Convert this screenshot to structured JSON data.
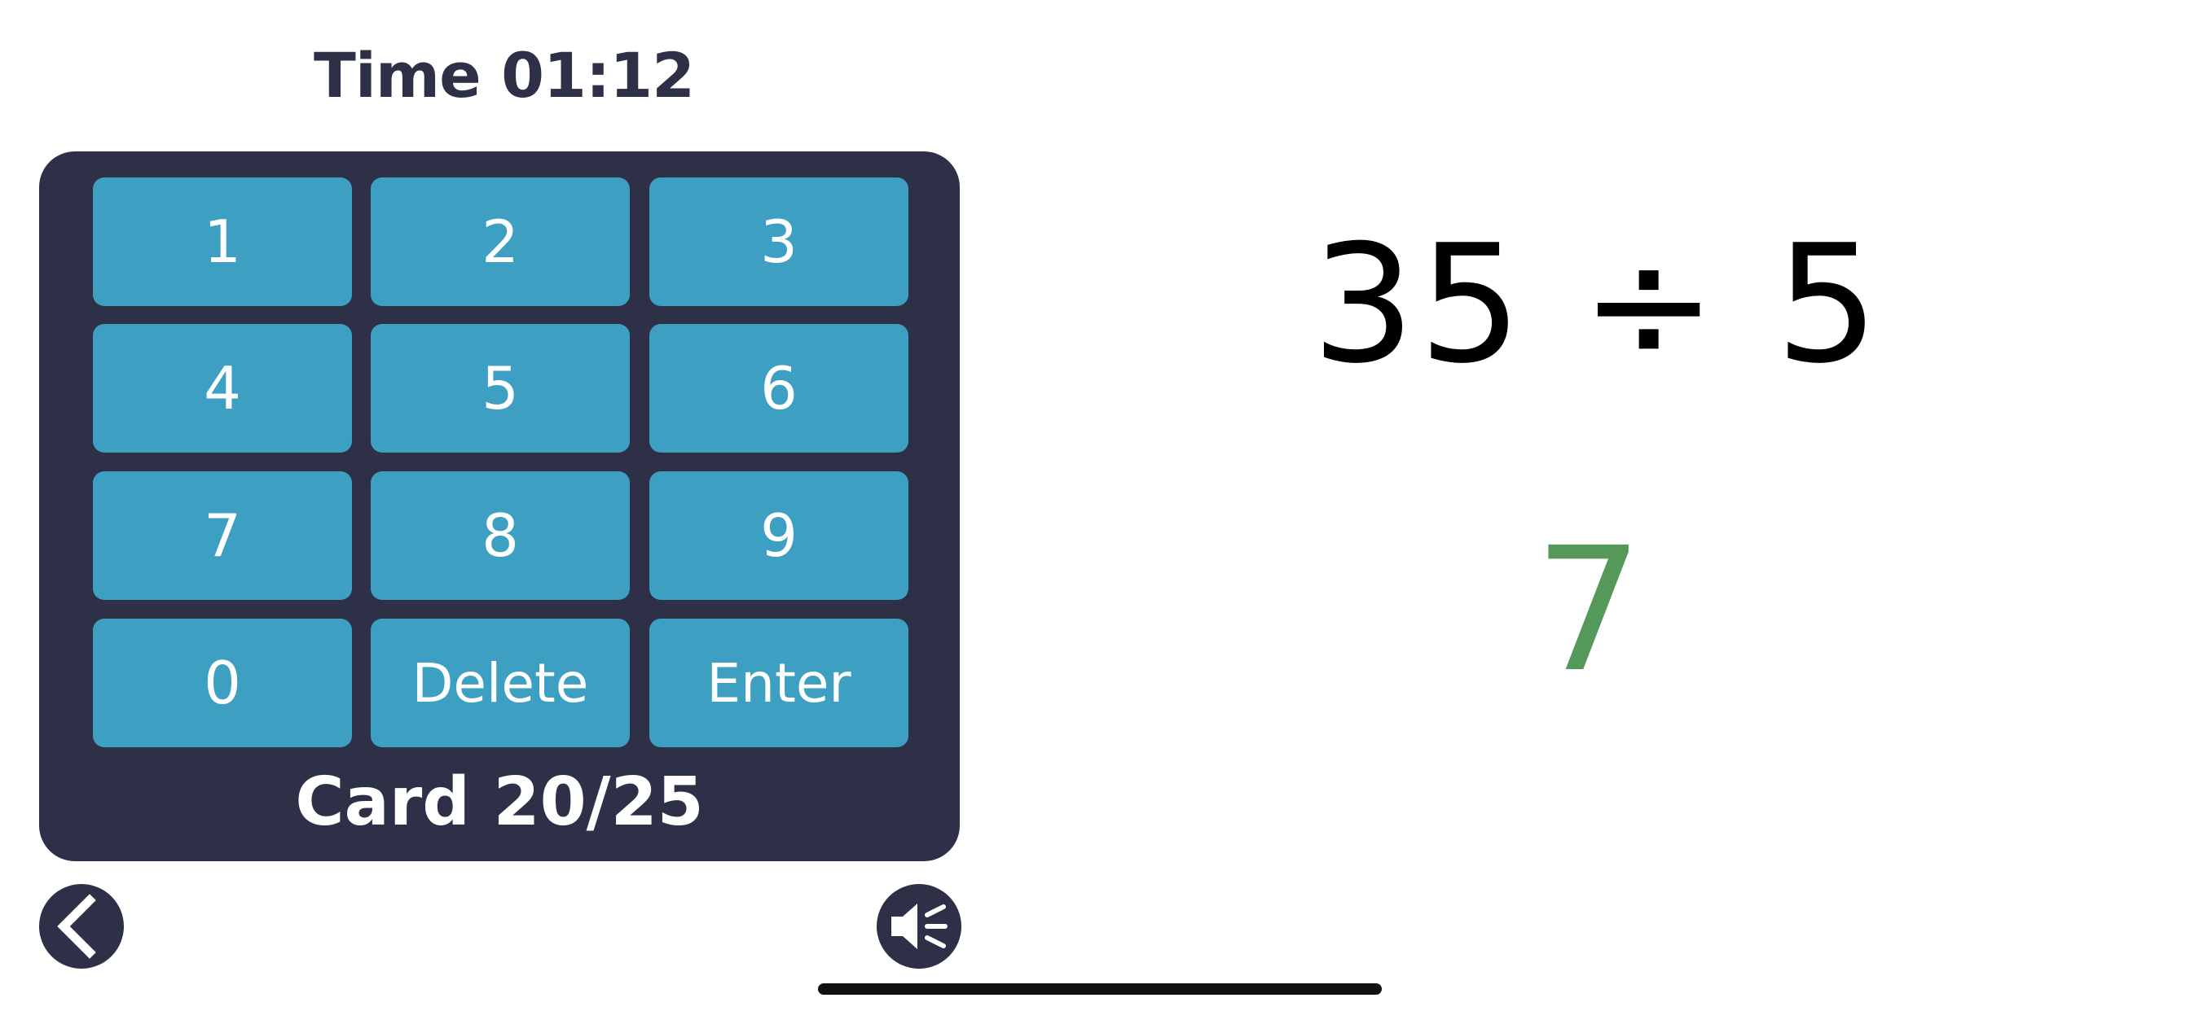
{
  "timer": {
    "text": "Time 01:12"
  },
  "keypad": {
    "keys": [
      "1",
      "2",
      "3",
      "4",
      "5",
      "6",
      "7",
      "8",
      "9",
      "0",
      "Delete",
      "Enter"
    ]
  },
  "card_counter": {
    "text": "Card 20/25"
  },
  "problem": {
    "text": "35 ÷ 5"
  },
  "answer": {
    "text": "7"
  },
  "icons": {
    "back": "back-arrow-icon",
    "sound": "speaker-icon"
  },
  "colors": {
    "panel": "#2e3048",
    "key": "#3d9fc1",
    "key_text": "#ffffff",
    "answer": "#54995a",
    "problem": "#000000"
  }
}
